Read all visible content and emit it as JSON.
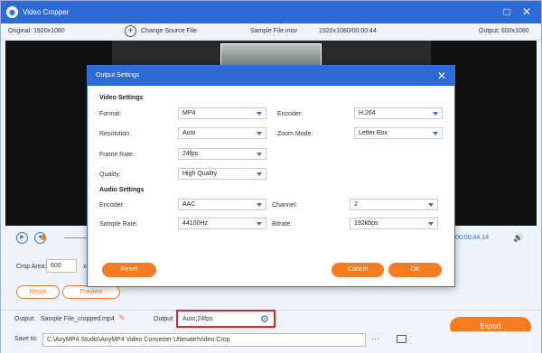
{
  "window": {
    "title": "Video Cropper"
  },
  "infobar": {
    "original": "Original: 1920x1080",
    "change_source": "Change Source File",
    "filename": "Sample File.mov",
    "meta": "1920x1080/00:00:44",
    "output": "Output: 600x1080"
  },
  "player": {
    "time": "00:00:44.14"
  },
  "crop": {
    "label": "Crop Area:",
    "width": "600",
    "x": "x"
  },
  "buttons": {
    "reset": "Reset",
    "preview": "Preview",
    "export": "Export"
  },
  "footer": {
    "output_label": "Output:",
    "output_file": "Sample File_cropped.mp4",
    "output_label2": "Output:",
    "output_value": "Auto;24fps",
    "save_label": "Save to:",
    "save_path": "C:\\AnyMP4 Studio\\AnyMP4 Video Converter Ultimate\\Video Crop"
  },
  "modal": {
    "title": "Output Settings",
    "video_section": "Video Settings",
    "audio_section": "Audio Settings",
    "format_label": "Format:",
    "format_value": "MP4",
    "encoder_label": "Encoder:",
    "encoder_value": "H.264",
    "resolution_label": "Resolution:",
    "resolution_value": "Auto",
    "zoom_label": "Zoom Mode:",
    "zoom_value": "Letter Box",
    "framerate_label": "Frame Rate:",
    "framerate_value": "24fps",
    "quality_label": "Quality:",
    "quality_value": "High Quality",
    "aencoder_label": "Encoder:",
    "aencoder_value": "AAC",
    "channel_label": "Channel:",
    "channel_value": "2",
    "samplerate_label": "Sample Rate:",
    "samplerate_value": "44100Hz",
    "bitrate_label": "Bitrate:",
    "bitrate_value": "192kbps",
    "reset": "Reset",
    "cancel": "Cancel",
    "ok": "OK"
  },
  "colors": {
    "accent": "#2e6bd6",
    "orange": "#f57c22",
    "highlight": "#d9262c"
  }
}
